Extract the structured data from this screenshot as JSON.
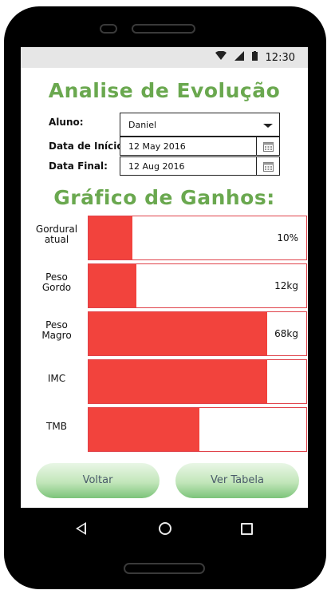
{
  "statusbar": {
    "time": "12:30"
  },
  "header": {
    "title": "Analise de Evolução"
  },
  "form": {
    "aluno_label": "Aluno:",
    "aluno_value": "Daniel",
    "inicio_label": "Data de Início:",
    "inicio_value": "12 May 2016",
    "final_label": "Data Final:",
    "final_value": "12 Aug 2016"
  },
  "chart_heading": "Gráfico de Ganhos:",
  "chart_data": {
    "type": "bar",
    "orientation": "horizontal",
    "categories": [
      "Gordural atual",
      "Peso Gordo",
      "Peso Magro",
      "IMC",
      "TMB"
    ],
    "label_lines": [
      [
        "Gordural",
        "atual"
      ],
      [
        "Peso",
        "Gordo"
      ],
      [
        "Peso",
        "Magro"
      ],
      [
        "IMC"
      ],
      [
        "TMB"
      ]
    ],
    "fill_fraction": [
      0.2,
      0.22,
      0.82,
      0.82,
      0.51
    ],
    "value_labels": [
      "10%",
      "12kg",
      "68kg",
      "",
      ""
    ],
    "bar_color": "#f2433d",
    "border_color": "#e0434b"
  },
  "actions": {
    "voltar": "Voltar",
    "ver_tabela": "Ver Tabela"
  },
  "colors": {
    "title_green": "#6aa84f",
    "button_green": "#7cc47a"
  }
}
